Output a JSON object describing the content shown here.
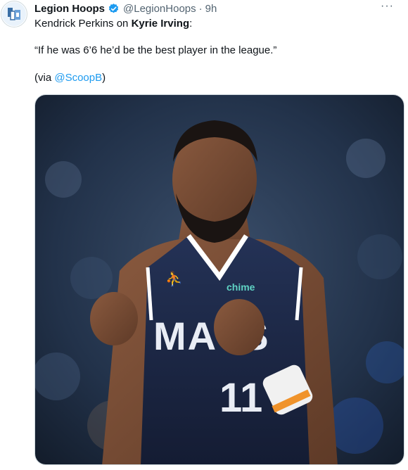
{
  "tweet": {
    "author_name": "Legion Hoops",
    "author_handle": "@LegionHoops",
    "separator": "·",
    "timestamp": "9h",
    "more_label": "···",
    "line1_prefix": "Kendrick Perkins on ",
    "line1_subject": "Kyrie Irving",
    "line1_suffix": ":",
    "quote": "“If he was 6’6 he’d be the best player in the league.”",
    "via_prefix": "(via ",
    "via_mention": "@ScoopB",
    "via_suffix": ")"
  },
  "media": {
    "jersey_wordmark": "MAVS",
    "jersey_number": "11",
    "sponsor_patch": "chime"
  },
  "icons": {
    "verified": "verified-badge-icon",
    "more": "more-dots-icon",
    "avatar": "legion-hoops-logo-icon"
  },
  "colors": {
    "accent": "#1d9bf0",
    "text_primary": "#0f1419",
    "text_secondary": "#536471",
    "jersey_navy": "#1c2744"
  }
}
